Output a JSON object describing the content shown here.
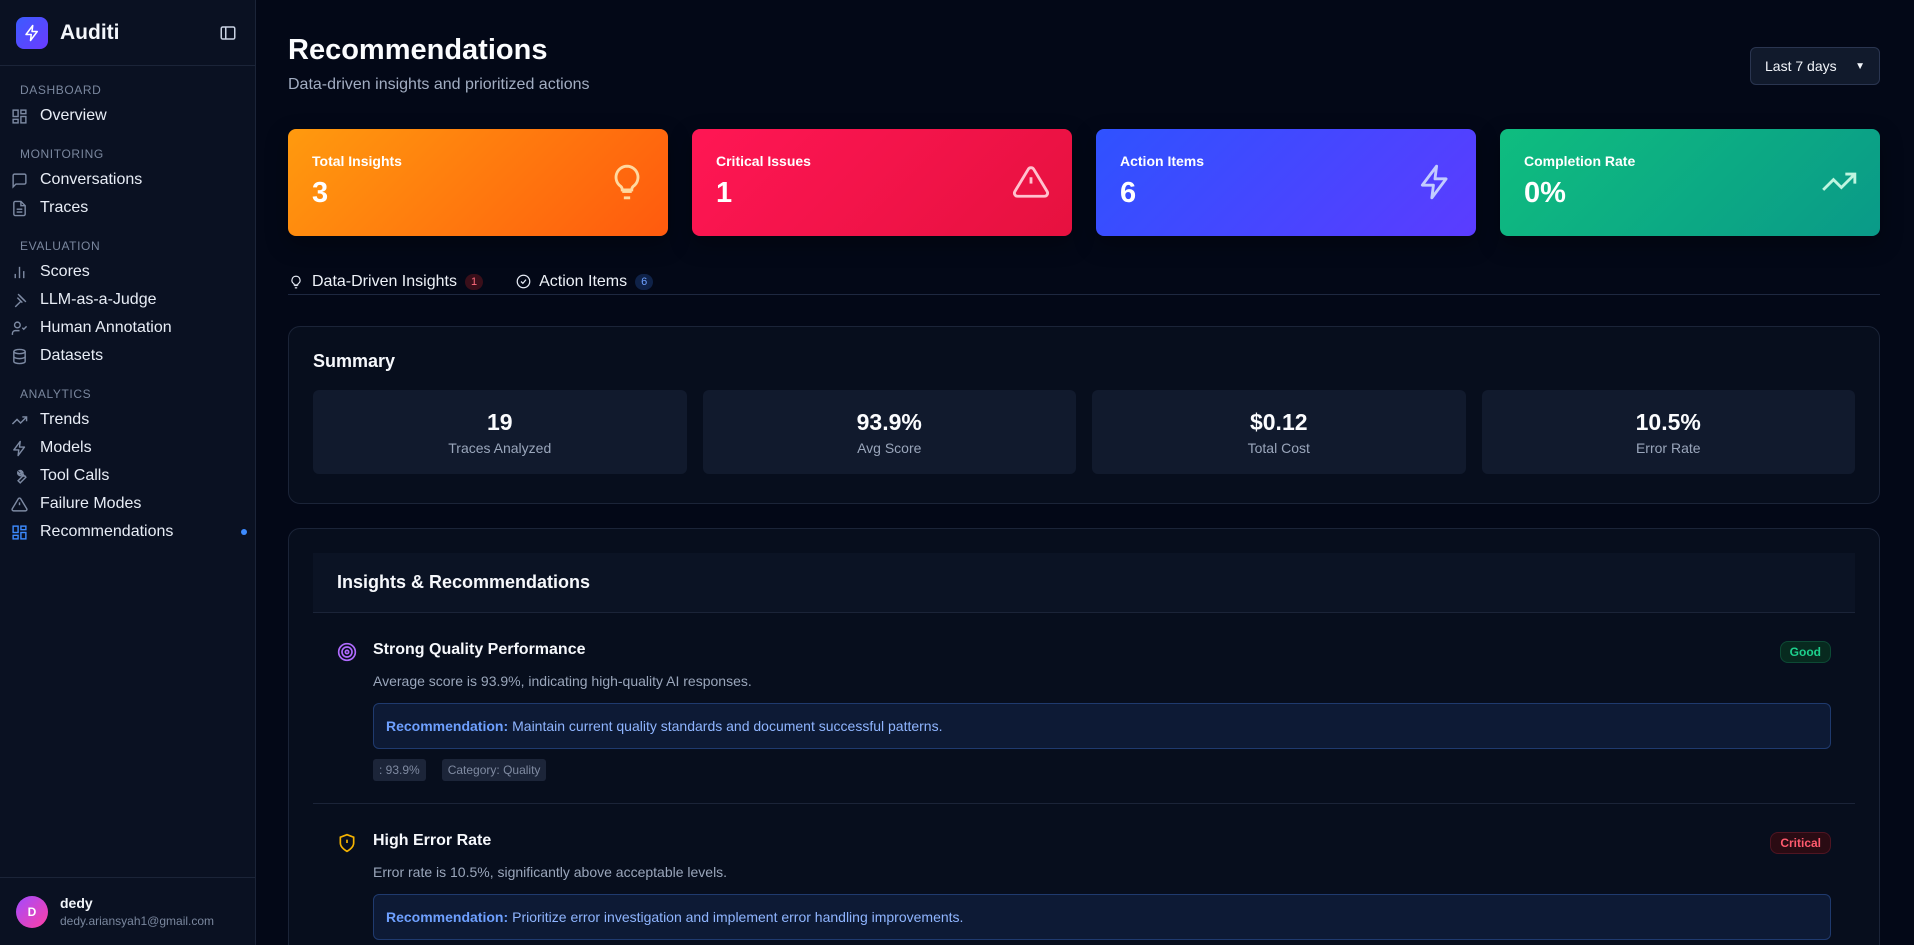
{
  "app": {
    "name": "Auditi"
  },
  "sidebar": {
    "sections": [
      {
        "heading": "DASHBOARD",
        "items": [
          {
            "label": "Overview",
            "icon": "grid-icon"
          }
        ]
      },
      {
        "heading": "MONITORING",
        "items": [
          {
            "label": "Conversations",
            "icon": "message-icon"
          },
          {
            "label": "Traces",
            "icon": "document-icon"
          }
        ]
      },
      {
        "heading": "EVALUATION",
        "items": [
          {
            "label": "Scores",
            "icon": "bar-chart-icon"
          },
          {
            "label": "LLM-as-a-Judge",
            "icon": "gavel-icon"
          },
          {
            "label": "Human Annotation",
            "icon": "user-check-icon"
          },
          {
            "label": "Datasets",
            "icon": "database-icon"
          }
        ]
      },
      {
        "heading": "ANALYTICS",
        "items": [
          {
            "label": "Trends",
            "icon": "trending-up-icon"
          },
          {
            "label": "Models",
            "icon": "zap-icon"
          },
          {
            "label": "Tool Calls",
            "icon": "wrench-icon"
          },
          {
            "label": "Failure Modes",
            "icon": "alert-triangle-icon"
          },
          {
            "label": "Recommendations",
            "icon": "grid-icon",
            "active": true
          }
        ]
      }
    ]
  },
  "user": {
    "initial": "D",
    "name": "dedy",
    "email": "dedy.ariansyah1@gmail.com"
  },
  "header": {
    "title": "Recommendations",
    "subtitle": "Data-driven insights and prioritized actions",
    "range": "Last 7 days"
  },
  "stats": [
    {
      "label": "Total Insights",
      "value": "3",
      "icon": "lightbulb-icon"
    },
    {
      "label": "Critical Issues",
      "value": "1",
      "icon": "alert-triangle-icon"
    },
    {
      "label": "Action Items",
      "value": "6",
      "icon": "zap-icon"
    },
    {
      "label": "Completion Rate",
      "value": "0%",
      "icon": "trending-up-icon"
    }
  ],
  "tabs": [
    {
      "label": "Data-Driven Insights",
      "count": "1",
      "icon": "lightbulb-icon"
    },
    {
      "label": "Action Items",
      "count": "6",
      "icon": "check-circle-icon"
    }
  ],
  "summary": {
    "title": "Summary",
    "cards": [
      {
        "value": "19",
        "label": "Traces Analyzed"
      },
      {
        "value": "93.9%",
        "label": "Avg Score"
      },
      {
        "value": "$0.12",
        "label": "Total Cost"
      },
      {
        "value": "10.5%",
        "label": "Error Rate"
      }
    ]
  },
  "insights": {
    "title": "Insights & Recommendations",
    "items": [
      {
        "title": "Strong Quality Performance",
        "description": "Average score is 93.9%, indicating high-quality AI responses.",
        "reco_label": "Recommendation:",
        "reco_text": "Maintain current quality standards and document successful patterns.",
        "chips": [
          ": 93.9%",
          "Category: Quality"
        ],
        "status": "Good",
        "icon": "target-icon"
      },
      {
        "title": "High Error Rate",
        "description": "Error rate is 10.5%, significantly above acceptable levels.",
        "reco_label": "Recommendation:",
        "reco_text": "Prioritize error investigation and implement error handling improvements.",
        "status": "Critical",
        "icon": "shield-alert-icon"
      }
    ]
  }
}
